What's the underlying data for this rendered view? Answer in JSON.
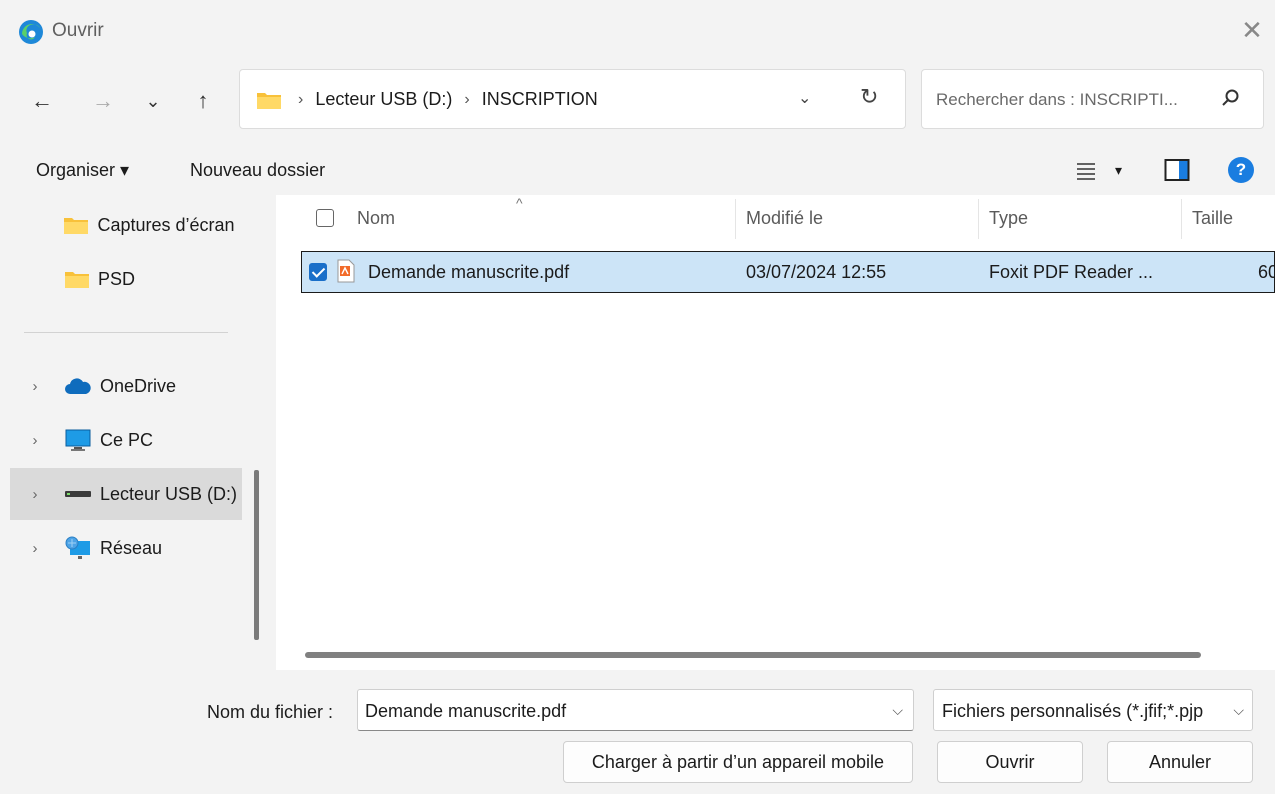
{
  "window": {
    "title": "Ouvrir",
    "close_symbol": "✕"
  },
  "nav": {
    "back": "←",
    "forward": "→",
    "recent": "⌄",
    "up": "↑",
    "breadcrumb": [
      "Lecteur USB (D:)",
      "INSCRIPTION"
    ],
    "breadcrumb_sep": "›",
    "refresh": "↻",
    "search_placeholder": "Rechercher dans : INSCRIPTI..."
  },
  "toolbar": {
    "organize": "Organiser ▾",
    "new_folder": "Nouveau dossier",
    "view_caret": "▾",
    "help": "?"
  },
  "sidebar": {
    "items": [
      {
        "label": "Captures d’écran",
        "icon": "folder-icon"
      },
      {
        "label": "PSD",
        "icon": "folder-icon"
      },
      {
        "label": "OneDrive",
        "icon": "cloud-icon"
      },
      {
        "label": "Ce PC",
        "icon": "monitor-icon"
      },
      {
        "label": "Lecteur USB (D:)",
        "icon": "usb-drive-icon",
        "selected": true
      },
      {
        "label": "Réseau",
        "icon": "network-icon"
      }
    ],
    "expand_symbol": "›"
  },
  "file_list": {
    "columns": [
      "Nom",
      "Modifié le",
      "Type",
      "Taille"
    ],
    "sort_caret": "^",
    "rows": [
      {
        "name": "Demande manuscrite.pdf",
        "modified": "03/07/2024 12:55",
        "type": "Foxit PDF Reader ...",
        "size": "60",
        "selected": true
      }
    ]
  },
  "bottom": {
    "filename_label": "Nom du fichier :",
    "filename_value": "Demande manuscrite.pdf",
    "filetype_value": "Fichiers personnalisés (*.jfif;*.pjp",
    "dropdown_symbol": "⌵",
    "mobile_button": "Charger à partir d’un appareil mobile",
    "open_button": "Ouvrir",
    "cancel_button": "Annuler"
  },
  "colors": {
    "accent": "#1a6fc9",
    "selection": "#cce4f7",
    "folder": "#f8c13a",
    "help": "#1a7de0"
  }
}
